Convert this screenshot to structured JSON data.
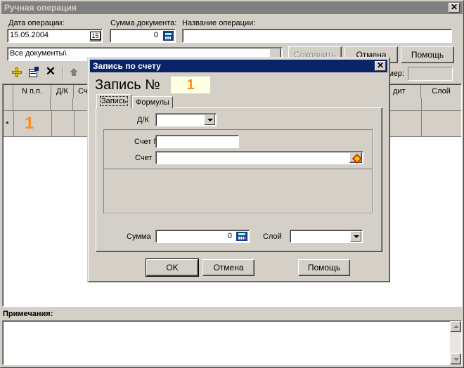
{
  "main_window": {
    "title": "Ручная операция",
    "date_label": "Дата операции:",
    "date_value": "15.05.2004",
    "calendar_glyph": "15",
    "sum_label": "Сумма документа:",
    "sum_value": "0",
    "opname_label": "Название операции:",
    "opname_value": "",
    "folder_value": "Все документы\\",
    "save_button": "Сохранить",
    "cancel_button": "Отмена",
    "help_button": "Помощь",
    "number_label": "мер:",
    "grid_headers": [
      "N п.п.",
      "Д/К",
      "Сч",
      "дит",
      "Слой"
    ],
    "row_marker": "*",
    "row_number": "1",
    "notes_label": "Примечания:",
    "notes_value": ""
  },
  "dialog": {
    "title": "Запись по счету",
    "record_label": "Запись №",
    "record_number": "1",
    "tabs": [
      "Запись",
      "Формулы"
    ],
    "dk_label": "Д/К",
    "dk_value": "",
    "account_no_label": "Счет №",
    "account_no_value": "",
    "account_label": "Счет",
    "account_value": "",
    "sum_label": "Сумма",
    "sum_value": "0",
    "layer_label": "Слой",
    "layer_value": "",
    "ok_button": "OK",
    "cancel_button": "Отмена",
    "help_button": "Помощь"
  },
  "colors": {
    "face": "#d4d0c8",
    "active_title": "#0a246a",
    "inactive_title": "#808080",
    "number_orange": "#ff8c1a",
    "number_bg": "#ffffe1"
  }
}
